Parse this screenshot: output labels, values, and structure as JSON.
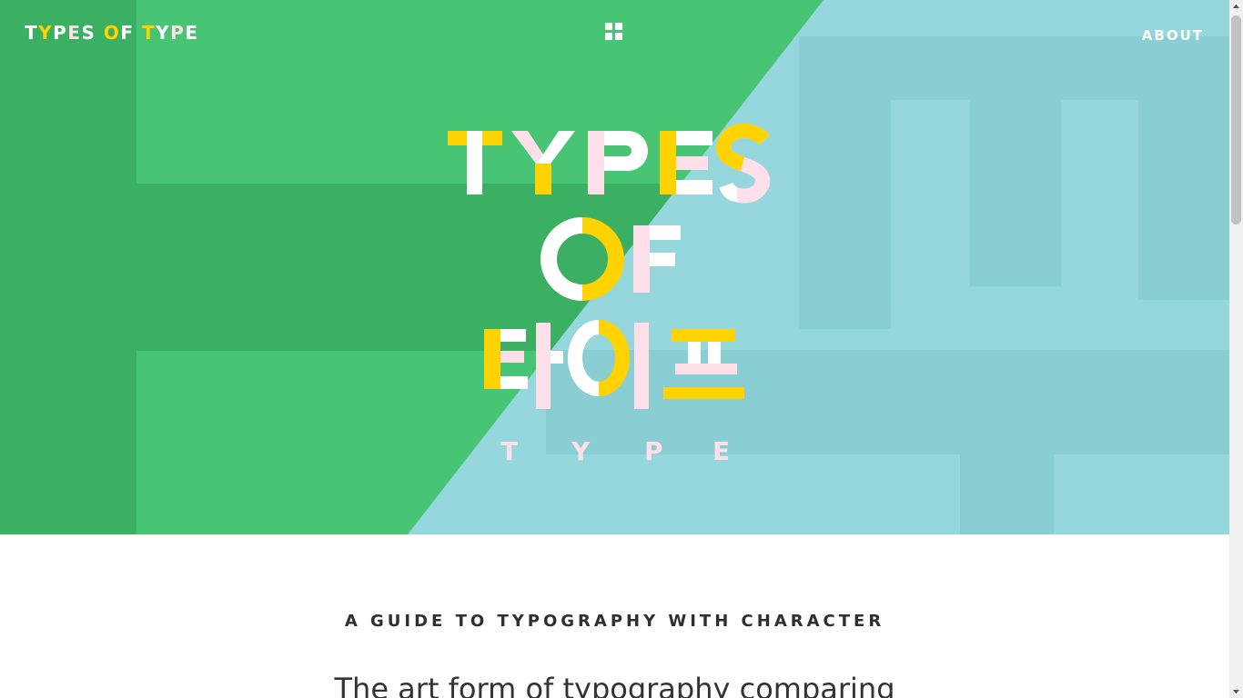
{
  "nav": {
    "logo_parts": [
      "T",
      "Y",
      "P",
      "E",
      "S",
      " ",
      "O",
      "F",
      " ",
      "T",
      "Y",
      "P",
      "E"
    ],
    "menu_icon": "grid-icon",
    "about_label": "ABOUT"
  },
  "hero": {
    "title_line1_letters": [
      "T",
      "Y",
      "P",
      "E",
      "S"
    ],
    "title_line2_letters": [
      "O",
      "F"
    ],
    "korean_jamo": [
      "ㅌ",
      "ㅏ",
      "ㅇ",
      "ㅣ",
      "ㅍ"
    ],
    "subtitle_letters": [
      "T",
      "Y",
      "P",
      "E"
    ]
  },
  "content": {
    "tagline": "A GUIDE TO TYPOGRAPHY WITH CHARACTER",
    "intro": "The art form of typography comparing"
  },
  "colors": {
    "green": "#47c474",
    "green_dark": "#3cb062",
    "teal": "#96d7dd",
    "teal_dark": "#89ced3",
    "yellow": "#ffd200",
    "pink": "#ffe0ea",
    "white": "#ffffff",
    "text": "#2f2f2f"
  }
}
